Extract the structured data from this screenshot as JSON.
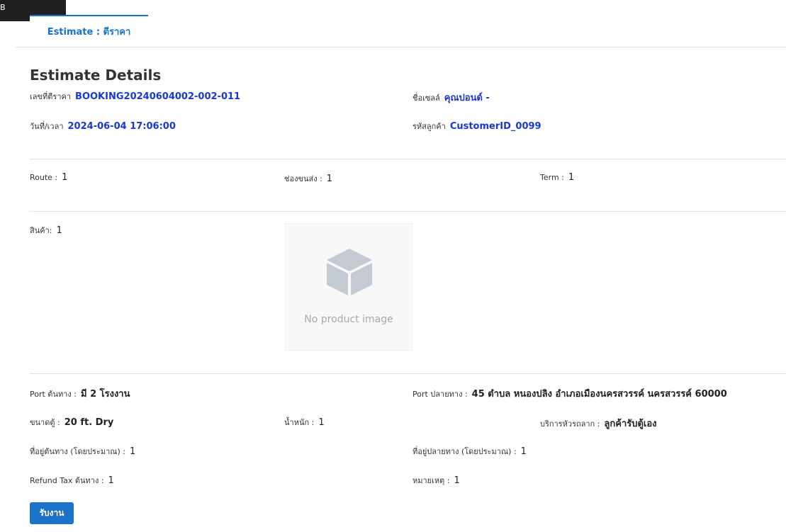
{
  "corner_label": "B",
  "tab": {
    "label": "Estimate : ตีราคา"
  },
  "details": {
    "title": "Estimate Details",
    "estimate_no_label": "เลขที่ตีราคา",
    "estimate_no": "BOOKING20240604002-002-011",
    "sales_name_label": "ชื่อเซลล์",
    "sales_name": "คุณปอนด์ -",
    "datetime_label": "วันที่/เวลา",
    "datetime": "2024-06-04 17:06:00",
    "customer_id_label": "รหัสลูกค้า",
    "customer_id": "CustomerID_0099"
  },
  "route": {
    "route_label": "Route :",
    "route_value": "1",
    "channel_label": "ช่องขนส่ง :",
    "channel_value": "1",
    "term_label": "Term :",
    "term_value": "1"
  },
  "product": {
    "label": "สินค้า:",
    "value": "1",
    "no_image_text": "No product image",
    "icon": "box-icon"
  },
  "shipping": {
    "port_origin_label": "Port ต้นทาง :",
    "port_origin_value": "มี 2 โรงงาน",
    "port_dest_label": "Port ปลายทาง :",
    "port_dest_value": "45 ตำบล หนองปลิง อำเภอเมืองนครสวรรค์ นครสวรรค์ 60000",
    "container_size_label": "ขนาดตู้ :",
    "container_size_value": "20 ft. Dry",
    "weight_label": "น้ำหนัก :",
    "weight_value": "1",
    "tractor_service_label": "บริการหัวรถลาก :",
    "tractor_service_value": "ลูกค้ารับตู้เอง",
    "origin_address_label": "ที่อยู่ต้นทาง (โดยประมาณ) :",
    "origin_address_value": "1",
    "dest_address_label": "ที่อยู่ปลายทาง (โดยประมาณ) :",
    "dest_address_value": "1",
    "refund_tax_label": "Refund Tax ต้นทาง :",
    "refund_tax_value": "1",
    "note_label": "หมายเหตุ :",
    "note_value": "1"
  },
  "actions": {
    "accept_label": "รับงาน"
  },
  "colors": {
    "accent": "#1a73c9",
    "value_blue": "#1838d6"
  }
}
